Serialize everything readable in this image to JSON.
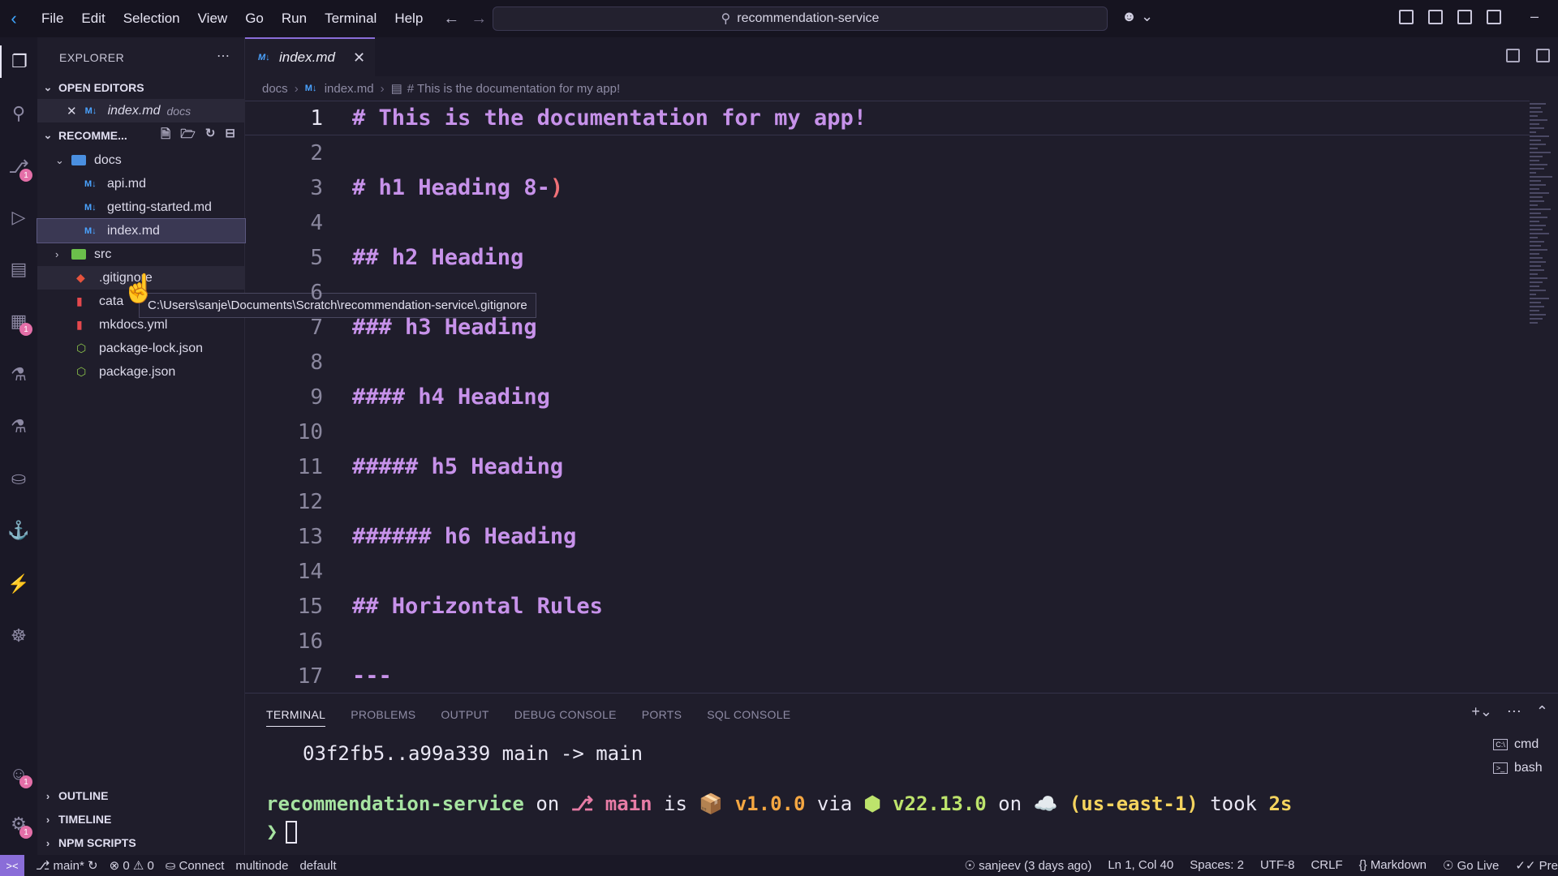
{
  "menubar": [
    "File",
    "Edit",
    "Selection",
    "View",
    "Go",
    "Run",
    "Terminal",
    "Help"
  ],
  "command_center": "recommendation-service",
  "explorer": {
    "title": "EXPLORER",
    "open_editors_label": "OPEN EDITORS",
    "open_editor_file": "index.md",
    "open_editor_desc": "docs",
    "project_label": "RECOMME...",
    "tree": {
      "docs": "docs",
      "api": "api.md",
      "getting_started": "getting-started.md",
      "index": "index.md",
      "src": "src",
      "gitignore": ".gitignore",
      "cata": "cata",
      "mkdocs": "mkdocs.yml",
      "package_lock": "package-lock.json",
      "package": "package.json"
    },
    "tooltip": "C:\\Users\\sanje\\Documents\\Scratch\\recommendation-service\\.gitignore",
    "outline": "OUTLINE",
    "timeline": "TIMELINE",
    "npm_scripts": "NPM SCRIPTS"
  },
  "tab": {
    "label": "index.md",
    "icon": "M↓"
  },
  "breadcrumb": {
    "folder": "docs",
    "file": "index.md",
    "symbol": "# This is the documentation for my app!"
  },
  "editor": {
    "lines": [
      {
        "n": "1",
        "text": "# This is the documentation for my app!"
      },
      {
        "n": "2",
        "text": ""
      },
      {
        "n": "3",
        "text": "# h1 Heading 8-",
        "tail": ")"
      },
      {
        "n": "4",
        "text": ""
      },
      {
        "n": "5",
        "text": "## h2 Heading"
      },
      {
        "n": "6",
        "text": ""
      },
      {
        "n": "7",
        "text": "### h3 Heading"
      },
      {
        "n": "8",
        "text": ""
      },
      {
        "n": "9",
        "text": "#### h4 Heading"
      },
      {
        "n": "10",
        "text": ""
      },
      {
        "n": "11",
        "text": "##### h5 Heading"
      },
      {
        "n": "12",
        "text": ""
      },
      {
        "n": "13",
        "text": "###### h6 Heading"
      },
      {
        "n": "14",
        "text": ""
      },
      {
        "n": "15",
        "text": "## Horizontal Rules"
      },
      {
        "n": "16",
        "text": ""
      },
      {
        "n": "17",
        "text": "---"
      }
    ]
  },
  "panel": {
    "tabs": [
      "TERMINAL",
      "PROBLEMS",
      "OUTPUT",
      "DEBUG CONSOLE",
      "PORTS",
      "SQL CONSOLE"
    ],
    "terminal": {
      "line1": "03f2fb5..a99a339  main -> main",
      "prompt_dir": "recommendation-service",
      "on1": " on ",
      "branch": "⎇ main",
      "is": " is ",
      "pkg": "📦 v1.0.0",
      "via": " via ",
      "node": "⬢ v22.13.0",
      "on2": " on ",
      "cloud": "☁️ (us-east-1)",
      "took": " took ",
      "duration": "2s",
      "prompt_char": "❯"
    },
    "terminals": [
      "cmd",
      "bash"
    ]
  },
  "statusbar": {
    "branch": "main*",
    "errors": "0",
    "warnings": "0",
    "connect": "Connect",
    "multinode": "multinode",
    "default": "default",
    "blame": "sanjeev (3 days ago)",
    "position": "Ln 1, Col 40",
    "spaces": "Spaces: 2",
    "encoding": "UTF-8",
    "eol": "CRLF",
    "language": "Markdown",
    "golive": "Go Live",
    "prettier": "Pre"
  },
  "colors": {
    "accent": "#8a6dd8",
    "heading": "#c792ea",
    "badge": "#e46fa8"
  }
}
